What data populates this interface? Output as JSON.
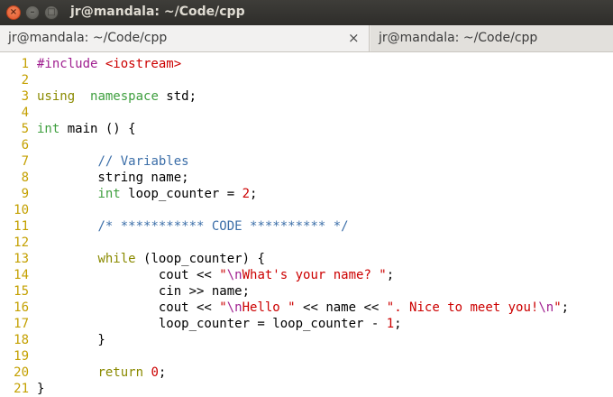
{
  "window": {
    "title": "jr@mandala: ~/Code/cpp"
  },
  "tabs": [
    {
      "label": "jr@mandala: ~/Code/cpp",
      "active": true,
      "close_glyph": "×"
    },
    {
      "label": "jr@mandala: ~/Code/cpp",
      "active": false
    }
  ],
  "window_buttons": {
    "close": "×",
    "minimize": "–",
    "maximize": "□"
  },
  "colors": {
    "line_numbers": "#c4a000",
    "keyword": "#8a8a00",
    "type": "#3f9f3f",
    "preprocessor": "#a02090",
    "string": "#cc0000",
    "comment": "#3b6ea8",
    "escape": "#a02090",
    "titlebar": "#3c3b37"
  },
  "lines": [
    {
      "n": "1",
      "t": [
        [
          "pp",
          "#include "
        ],
        [
          "str",
          "<iostream>"
        ]
      ]
    },
    {
      "n": "2",
      "t": []
    },
    {
      "n": "3",
      "t": [
        [
          "kw",
          "using"
        ],
        [
          "",
          "  "
        ],
        [
          "typ",
          "namespace"
        ],
        [
          "",
          " std;"
        ]
      ]
    },
    {
      "n": "4",
      "t": []
    },
    {
      "n": "5",
      "t": [
        [
          "typ",
          "int"
        ],
        [
          "",
          " main () {"
        ]
      ]
    },
    {
      "n": "6",
      "t": []
    },
    {
      "n": "7",
      "t": [
        [
          "",
          "        "
        ],
        [
          "cmt",
          "// Variables"
        ]
      ]
    },
    {
      "n": "8",
      "t": [
        [
          "",
          "        string name;"
        ]
      ]
    },
    {
      "n": "9",
      "t": [
        [
          "",
          "        "
        ],
        [
          "typ",
          "int"
        ],
        [
          "",
          " loop_counter = "
        ],
        [
          "num",
          "2"
        ],
        [
          "",
          ";"
        ]
      ]
    },
    {
      "n": "10",
      "t": []
    },
    {
      "n": "11",
      "t": [
        [
          "",
          "        "
        ],
        [
          "cmt",
          "/* *********** CODE ********** */"
        ]
      ]
    },
    {
      "n": "12",
      "t": []
    },
    {
      "n": "13",
      "t": [
        [
          "",
          "        "
        ],
        [
          "kw",
          "while"
        ],
        [
          "",
          " (loop_counter) {"
        ]
      ]
    },
    {
      "n": "14",
      "t": [
        [
          "",
          "                cout << "
        ],
        [
          "str",
          "\""
        ],
        [
          "esc",
          "\\n"
        ],
        [
          "str",
          "What's your name? \""
        ],
        [
          "",
          ";"
        ]
      ]
    },
    {
      "n": "15",
      "t": [
        [
          "",
          "                cin >> name;"
        ]
      ]
    },
    {
      "n": "16",
      "t": [
        [
          "",
          "                cout << "
        ],
        [
          "str",
          "\""
        ],
        [
          "esc",
          "\\n"
        ],
        [
          "str",
          "Hello \""
        ],
        [
          "",
          " << name << "
        ],
        [
          "str",
          "\". Nice to meet you!"
        ],
        [
          "esc",
          "\\n"
        ],
        [
          "str",
          "\""
        ],
        [
          "",
          ";"
        ]
      ]
    },
    {
      "n": "17",
      "t": [
        [
          "",
          "                loop_counter = loop_counter - "
        ],
        [
          "num",
          "1"
        ],
        [
          "",
          ";"
        ]
      ]
    },
    {
      "n": "18",
      "t": [
        [
          "",
          "        }"
        ]
      ]
    },
    {
      "n": "19",
      "t": []
    },
    {
      "n": "20",
      "t": [
        [
          "",
          "        "
        ],
        [
          "kw",
          "return"
        ],
        [
          "",
          ""
        ],
        [
          "",
          ""
        ],
        [
          "",
          " "
        ],
        [
          "num",
          "0"
        ],
        [
          "",
          ";"
        ]
      ]
    },
    {
      "n": "21",
      "t": [
        [
          "",
          "}"
        ]
      ]
    }
  ]
}
